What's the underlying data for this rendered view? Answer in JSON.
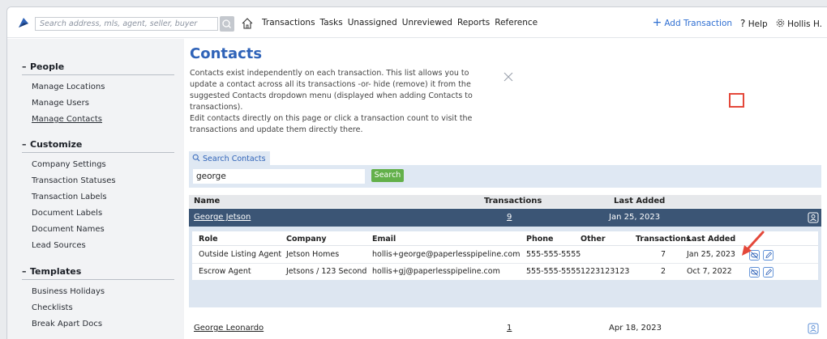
{
  "header": {
    "search_placeholder": "Search address, mls, agent, seller, buyer",
    "nav": [
      "Transactions",
      "Tasks",
      "Unassigned",
      "Unreviewed",
      "Reports",
      "Reference"
    ],
    "add_transaction": "Add Transaction",
    "help": "Help",
    "user": "Hollis H."
  },
  "sidebar": {
    "people": {
      "title": "People",
      "items": [
        "Manage Locations",
        "Manage Users",
        "Manage Contacts"
      ]
    },
    "customize": {
      "title": "Customize",
      "items": [
        "Company Settings",
        "Transaction Statuses",
        "Transaction Labels",
        "Document Labels",
        "Document Names",
        "Lead Sources"
      ]
    },
    "templates": {
      "title": "Templates",
      "items": [
        "Business Holidays",
        "Checklists",
        "Break Apart Docs"
      ]
    }
  },
  "main": {
    "title": "Contacts",
    "desc1": "Contacts exist independently on each transaction. This list allows you to update a contact across all its transactions -or- hide (remove) it from the suggested Contacts dropdown menu (displayed when adding Contacts to transactions).",
    "desc2": "Edit contacts directly on this page or click a transaction count to visit the transactions and update them directly there.",
    "search_tab": "Search Contacts",
    "search_value": "george",
    "search_button": "Search"
  },
  "table": {
    "headers": {
      "name": "Name",
      "transactions": "Transactions",
      "last_added": "Last Added"
    },
    "rows": [
      {
        "name": "George Jetson",
        "transactions": "9",
        "last_added": "Jan 25, 2023"
      },
      {
        "name": "George Leonardo",
        "transactions": "1",
        "last_added": "Apr 18, 2023"
      }
    ]
  },
  "sub_table": {
    "headers": {
      "role": "Role",
      "company": "Company",
      "email": "Email",
      "phone": "Phone",
      "other": "Other",
      "transactions": "Transactions",
      "last_added": "Last Added"
    },
    "rows": [
      {
        "role": "Outside Listing Agent",
        "company": "Jetson Homes",
        "email": "hollis+george@paperlesspipeline.com",
        "phone": "555-555-5555",
        "other": "",
        "transactions": "7",
        "last_added": "Jan 25, 2023"
      },
      {
        "role": "Escrow Agent",
        "company": "Jetsons / 123 Second",
        "email": "hollis+gj@paperlesspipeline.com",
        "phone": "555-555-5555",
        "other": "1223123123",
        "transactions": "2",
        "last_added": "Oct 7, 2022"
      }
    ]
  },
  "colors": {
    "accent": "#2f63b8",
    "selected_row": "#3b5575",
    "search_button": "#63b04a",
    "highlight": "#e4483a"
  }
}
